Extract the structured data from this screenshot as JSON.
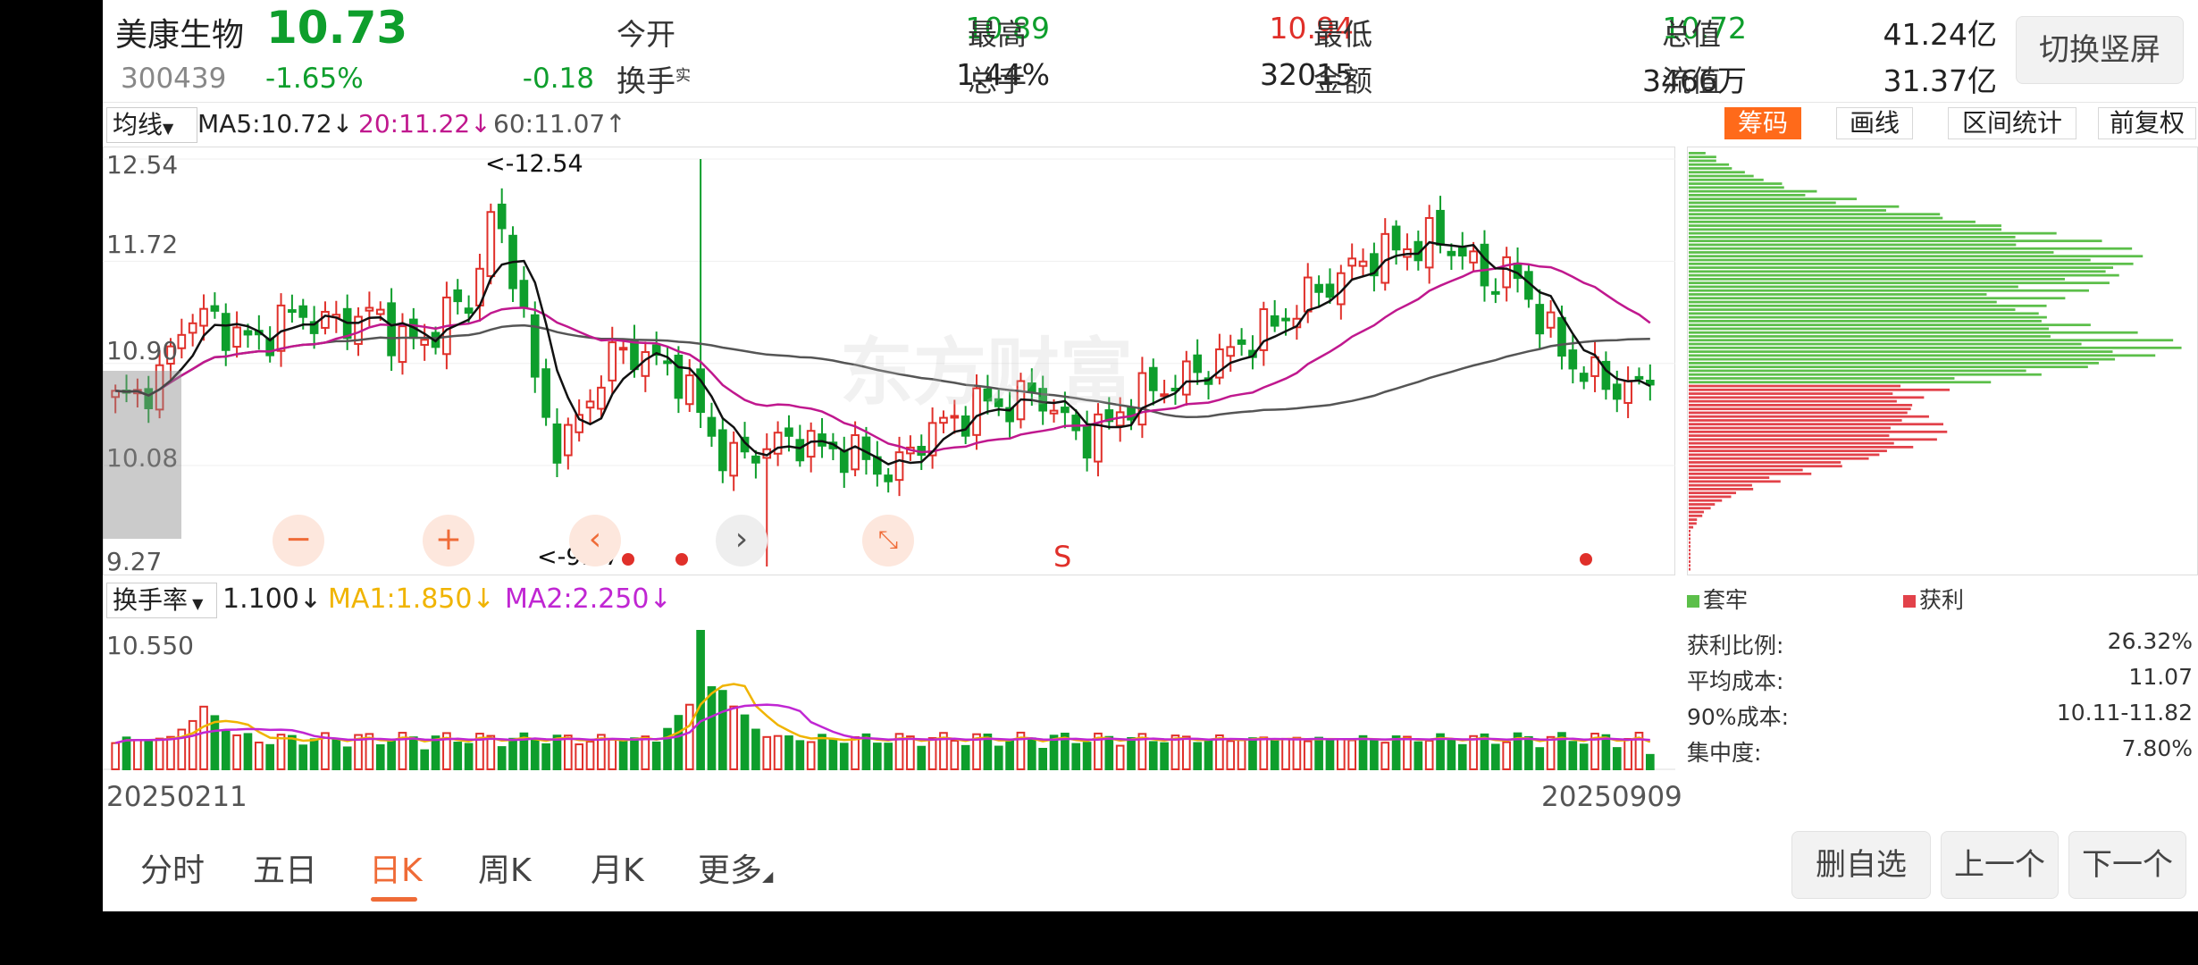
{
  "header": {
    "name": "美康生物",
    "price": "10.73",
    "code": "300439",
    "change_pct": "-1.65%",
    "change_amt": "-0.18",
    "open_label": "今开",
    "open": "10.89",
    "high_label": "最高",
    "high": "10.94",
    "low_label": "最低",
    "low": "10.72",
    "total_value_label": "总值",
    "total_value": "41.24亿",
    "turnover_label": "换手",
    "turnover_sup": "实",
    "turnover": "1.44%",
    "volume_label": "总手",
    "volume": "32015",
    "amount_label": "金额",
    "amount": "3466万",
    "float_value_label": "流值",
    "float_value": "31.37亿",
    "switch_button": "切换竖屏"
  },
  "ma_bar": {
    "selector": "均线",
    "ma5": "MA5:10.72",
    "ma20": "20:11.22",
    "ma60": "60:11.07",
    "ma5_arrow": "↓",
    "ma20_arrow": "↓",
    "ma60_arrow": "↑",
    "chips_tab": "筹码",
    "draw_tab": "画线",
    "range_stats_tab": "区间统计",
    "adjust_tab": "前复权"
  },
  "price_axis": [
    "12.54",
    "11.72",
    "10.90",
    "10.08",
    "9.27"
  ],
  "annotations": {
    "high": "<-12.54",
    "low": "<-9.27",
    "signal": "S"
  },
  "watermark": "东方财富",
  "turnover_bar": {
    "selector": "换手率",
    "value": "1.100",
    "value_arrow": "↓",
    "ma1": "MA1:1.850",
    "ma1_arrow": "↓",
    "ma2": "MA2:2.250",
    "ma2_arrow": "↓",
    "max": "10.550"
  },
  "dates": {
    "start": "20250211",
    "end": "20250909"
  },
  "chips_panel": {
    "legend_trapped": "套牢",
    "legend_profit": "获利",
    "stats": [
      {
        "label": "获利比例:",
        "value": "26.32%"
      },
      {
        "label": "平均成本:",
        "value": "11.07"
      },
      {
        "label": "90%成本:",
        "value": "10.11-11.82"
      },
      {
        "label": "集中度:",
        "value": "7.80%"
      }
    ]
  },
  "bottom_tabs": [
    "分时",
    "五日",
    "日K",
    "周K",
    "月K",
    "更多"
  ],
  "active_tab": "日K",
  "bottom_buttons": {
    "remove": "删自选",
    "prev": "上一个",
    "next": "下一个"
  },
  "colors": {
    "up": "#e0302a",
    "down": "#0e9e2c",
    "ma5": "#111111",
    "ma20": "#c0188e",
    "ma60": "#555555",
    "ma1": "#f0b400",
    "ma2": "#c026d3",
    "accent": "#ff6a1a"
  },
  "chart_data": {
    "type": "candlestick",
    "period": "daily",
    "x_range": [
      "20250211",
      "20250909"
    ],
    "ylim": [
      9.27,
      12.54
    ],
    "sessions": 140,
    "visible_high": 12.54,
    "visible_low": 9.27,
    "last_close": 10.73,
    "series": [
      {
        "name": "MA5",
        "last": 10.72
      },
      {
        "name": "MA20",
        "last": 11.22
      },
      {
        "name": "MA60",
        "last": 11.07
      }
    ],
    "close_path": [
      10.6,
      10.65,
      10.8,
      11.3,
      11.25,
      11.15,
      11.05,
      11.25,
      11.3,
      11.2,
      11.25,
      11.3,
      11.1,
      11.05,
      11.3,
      11.4,
      12.1,
      11.6,
      10.5,
      10.2,
      10.6,
      10.95,
      11.0,
      10.9,
      10.8,
      10.4,
      10.1,
      10.2,
      10.25,
      10.3,
      10.2,
      10.2,
      10.1,
      10.0,
      10.3,
      10.4,
      10.5,
      10.6,
      10.55,
      10.7,
      10.45,
      10.3,
      10.4,
      10.6,
      10.7,
      10.75,
      10.85,
      10.95,
      11.1,
      11.2,
      11.35,
      11.5,
      11.6,
      11.75,
      11.8,
      11.85,
      11.9,
      11.8,
      11.55,
      11.65,
      11.4,
      11.05,
      10.85,
      10.75,
      10.7,
      10.73
    ],
    "turnover": {
      "max": 10.55,
      "last": 1.1,
      "ma1": 1.85,
      "ma2": 2.25
    }
  }
}
